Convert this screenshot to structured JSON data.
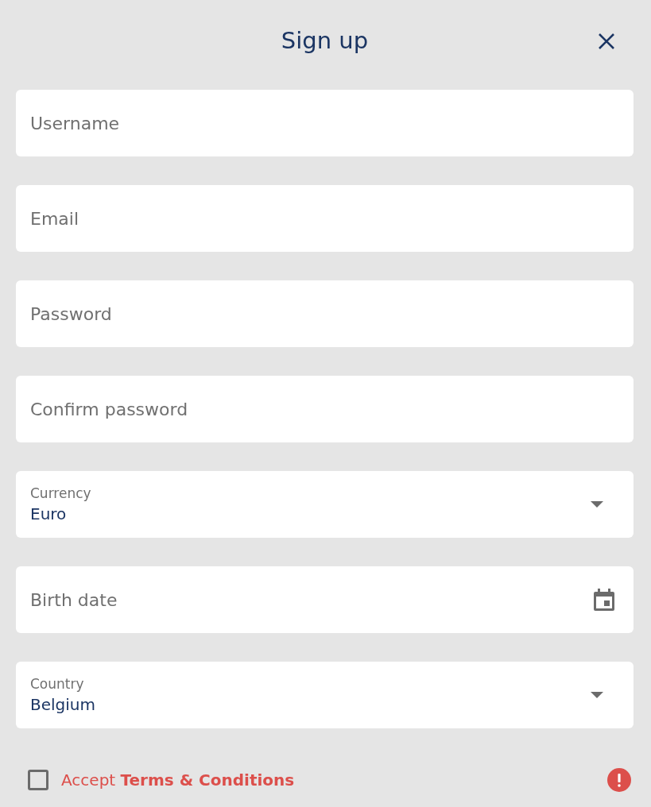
{
  "dialog": {
    "title": "Sign up"
  },
  "fields": [
    {
      "kind": "text",
      "placeholder": "Username"
    },
    {
      "kind": "text",
      "placeholder": "Email"
    },
    {
      "kind": "text",
      "placeholder": "Password"
    },
    {
      "kind": "text",
      "placeholder": "Confirm password"
    },
    {
      "kind": "select",
      "label": "Currency",
      "value": "Euro"
    },
    {
      "kind": "date",
      "placeholder": "Birth date"
    },
    {
      "kind": "select",
      "label": "Country",
      "value": "Belgium"
    }
  ],
  "consent": {
    "text": "Accept **Terms & Conditions**",
    "checked": false,
    "error": true
  }
}
